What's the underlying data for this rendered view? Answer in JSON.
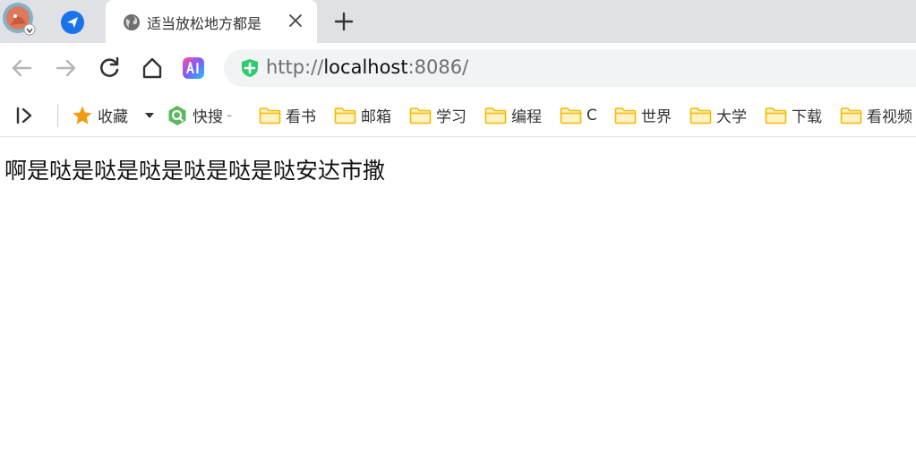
{
  "browser": {
    "tab": {
      "title": "适当放松地方都是"
    },
    "address": {
      "scheme": "http://",
      "host": "localhost",
      "port": ":8086/"
    }
  },
  "bookmarks": {
    "favorites_label": "收藏",
    "quicksearch_label": "快搜",
    "quicksearch_suffix": "-",
    "folders": [
      "看书",
      "邮箱",
      "学习",
      "编程",
      "C",
      "世界",
      "大学",
      "下载",
      "看视频"
    ]
  },
  "page": {
    "text": "啊是哒是哒是哒是哒是哒是哒安达市撒"
  },
  "colors": {
    "tabstrip": "#dfe1e5",
    "folder": "#f5c242",
    "star": "#f39c12",
    "shield": "#2ecc71",
    "pinned_icon": "#1a73e8"
  }
}
